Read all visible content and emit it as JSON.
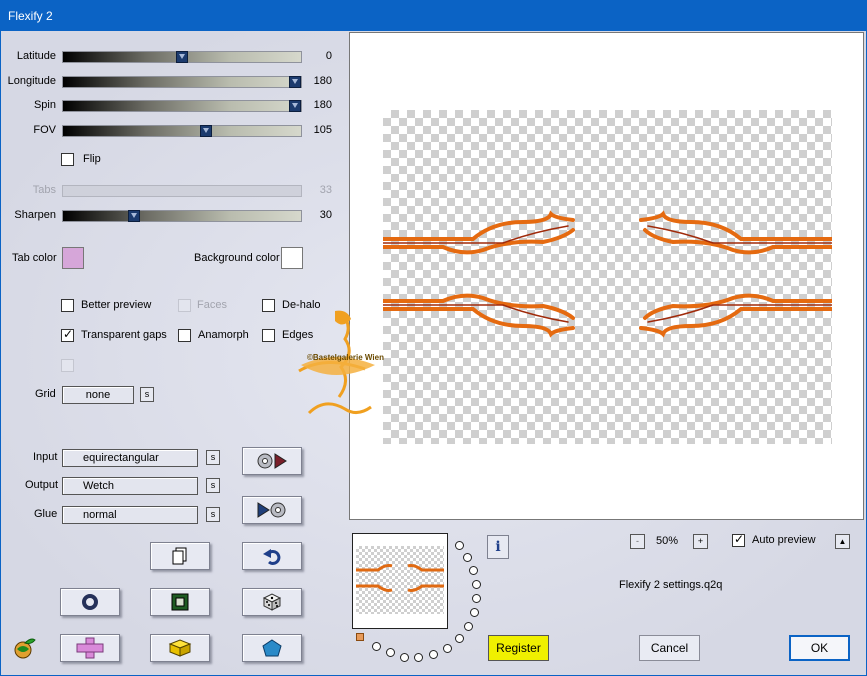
{
  "window": {
    "title": "Flexify 2"
  },
  "sliders": [
    {
      "id": "latitude",
      "label": "Latitude",
      "value": "0",
      "fraction": 0.5,
      "disabled": false
    },
    {
      "id": "longitude",
      "label": "Longitude",
      "value": "180",
      "fraction": 1.0,
      "disabled": false
    },
    {
      "id": "spin",
      "label": "Spin",
      "value": "180",
      "fraction": 1.0,
      "disabled": false
    },
    {
      "id": "fov",
      "label": "FOV",
      "value": "105",
      "fraction": 0.6,
      "disabled": false
    },
    {
      "id": "tabs",
      "label": "Tabs",
      "value": "33",
      "fraction": 0.33,
      "disabled": true
    },
    {
      "id": "sharpen",
      "label": "Sharpen",
      "value": "30",
      "fraction": 0.3,
      "disabled": false
    }
  ],
  "options": {
    "flip": {
      "label": "Flip",
      "checked": false
    },
    "better_preview": {
      "label": "Better preview",
      "checked": false
    },
    "faces": {
      "label": "Faces",
      "checked": false,
      "disabled": true
    },
    "de_halo": {
      "label": "De-halo",
      "checked": false
    },
    "transparent_gaps": {
      "label": "Transparent gaps",
      "checked": true
    },
    "anamorph": {
      "label": "Anamorph",
      "checked": false
    },
    "edges": {
      "label": "Edges",
      "checked": false
    },
    "check_mark": "✓"
  },
  "colors": {
    "tab_color_label": "Tab color",
    "tab_color": "#d6a6d9",
    "background_color_label": "Background color",
    "background_color": "#ffffff",
    "register_button": "#f0f000"
  },
  "grid": {
    "label": "Grid",
    "value": "none",
    "s_button": "s"
  },
  "projection": {
    "input": {
      "label": "Input",
      "value": "equirectangular",
      "s_button": "s"
    },
    "output": {
      "label": "Output",
      "value": "Wetch",
      "s_button": "s"
    },
    "glue": {
      "label": "Glue",
      "value": "normal",
      "s_button": "s"
    }
  },
  "icons": {
    "load_preset": "disc-play-icon",
    "save_preset": "play-disc-icon",
    "copy": "copy-pages-icon",
    "undo": "undo-arrow-icon",
    "ring": "ring-icon",
    "square": "square-frame-icon",
    "random": "dice-icon",
    "app_logo": "globe-leaf-icon",
    "cross": "cross-icon",
    "cube": "cube-icon",
    "pentagon": "pentagon-icon",
    "info": "info-icon"
  },
  "zoom": {
    "minus": "-",
    "value": "50%",
    "plus": "+"
  },
  "auto_preview": {
    "label": "Auto preview",
    "checked": true,
    "expand": "▲"
  },
  "settings_file": "Flexify 2 settings.q2q",
  "watermark": "©Bastelgalerie Wien",
  "buttons": {
    "info": "i",
    "register": "Register",
    "cancel": "Cancel",
    "ok": "OK"
  }
}
